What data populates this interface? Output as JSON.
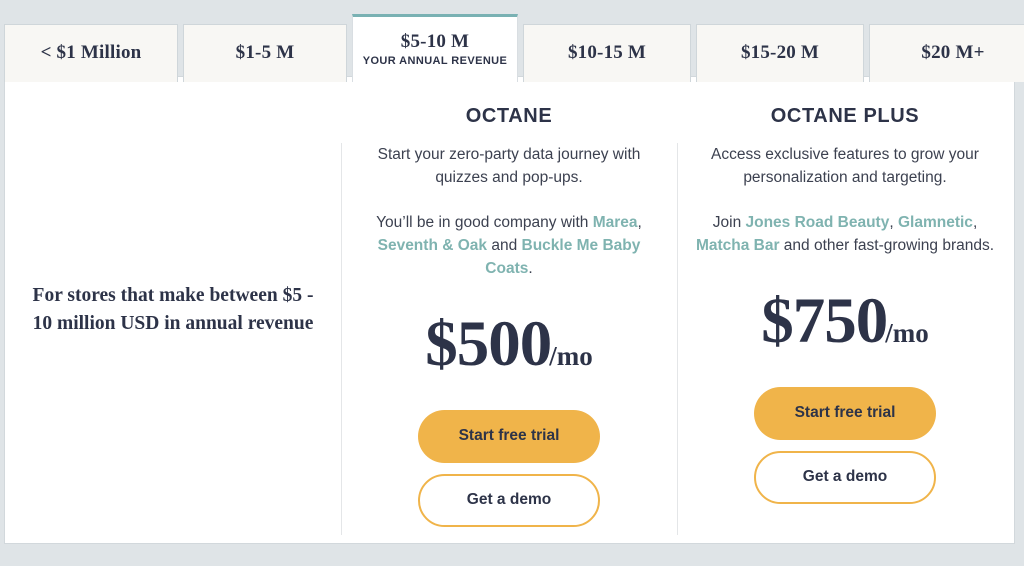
{
  "theme": {
    "page_background": "#dfe4e7",
    "panel_background": "#ffffff",
    "tab_background": "#f8f7f4",
    "active_tab_accent": "#79b1b3",
    "brand_link_color": "#7fb3b0",
    "button_primary_color": "#f0b44a",
    "text_color": "#2d3348"
  },
  "tabs": {
    "active_index": 2,
    "items": [
      {
        "label": "< $1 Million",
        "sublabel": "",
        "active": false
      },
      {
        "label": "$1-5 M",
        "sublabel": "",
        "active": false
      },
      {
        "label": "$5-10 M",
        "sublabel": "YOUR ANNUAL REVENUE",
        "active": true
      },
      {
        "label": "$10-15 M",
        "sublabel": "",
        "active": false
      },
      {
        "label": "$15-20 M",
        "sublabel": "",
        "active": false
      },
      {
        "label": "$20 M+",
        "sublabel": "",
        "active": false
      }
    ]
  },
  "description": {
    "text": "For stores that make between $5 - 10 million USD in annual revenue"
  },
  "plans": [
    {
      "name": "OCTANE",
      "blurb": "Start your zero-party data journey with quizzes and pop-ups.",
      "brands_prefix": "You’ll be in good company with ",
      "brand_1": "Marea",
      "brands_sep_1": ", ",
      "brand_2": "Seventh & Oak",
      "brands_sep_2": " and ",
      "brand_3": "Buckle Me Baby Coats",
      "brands_suffix": ".",
      "price_amount": "$500",
      "price_period": "/mo",
      "primary_button": "Start free trial",
      "secondary_button": "Get a demo"
    },
    {
      "name": "OCTANE PLUS",
      "blurb": "Access exclusive features to grow your personalization and targeting.",
      "brands_prefix": "Join ",
      "brand_1": "Jones Road Beauty",
      "brands_sep_1": ", ",
      "brand_2": "Glamnetic",
      "brands_sep_2": ", ",
      "brand_3": "Matcha Bar",
      "brands_suffix": " and other fast-growing brands.",
      "price_amount": "$750",
      "price_period": "/mo",
      "primary_button": "Start free trial",
      "secondary_button": "Get a demo"
    }
  ]
}
